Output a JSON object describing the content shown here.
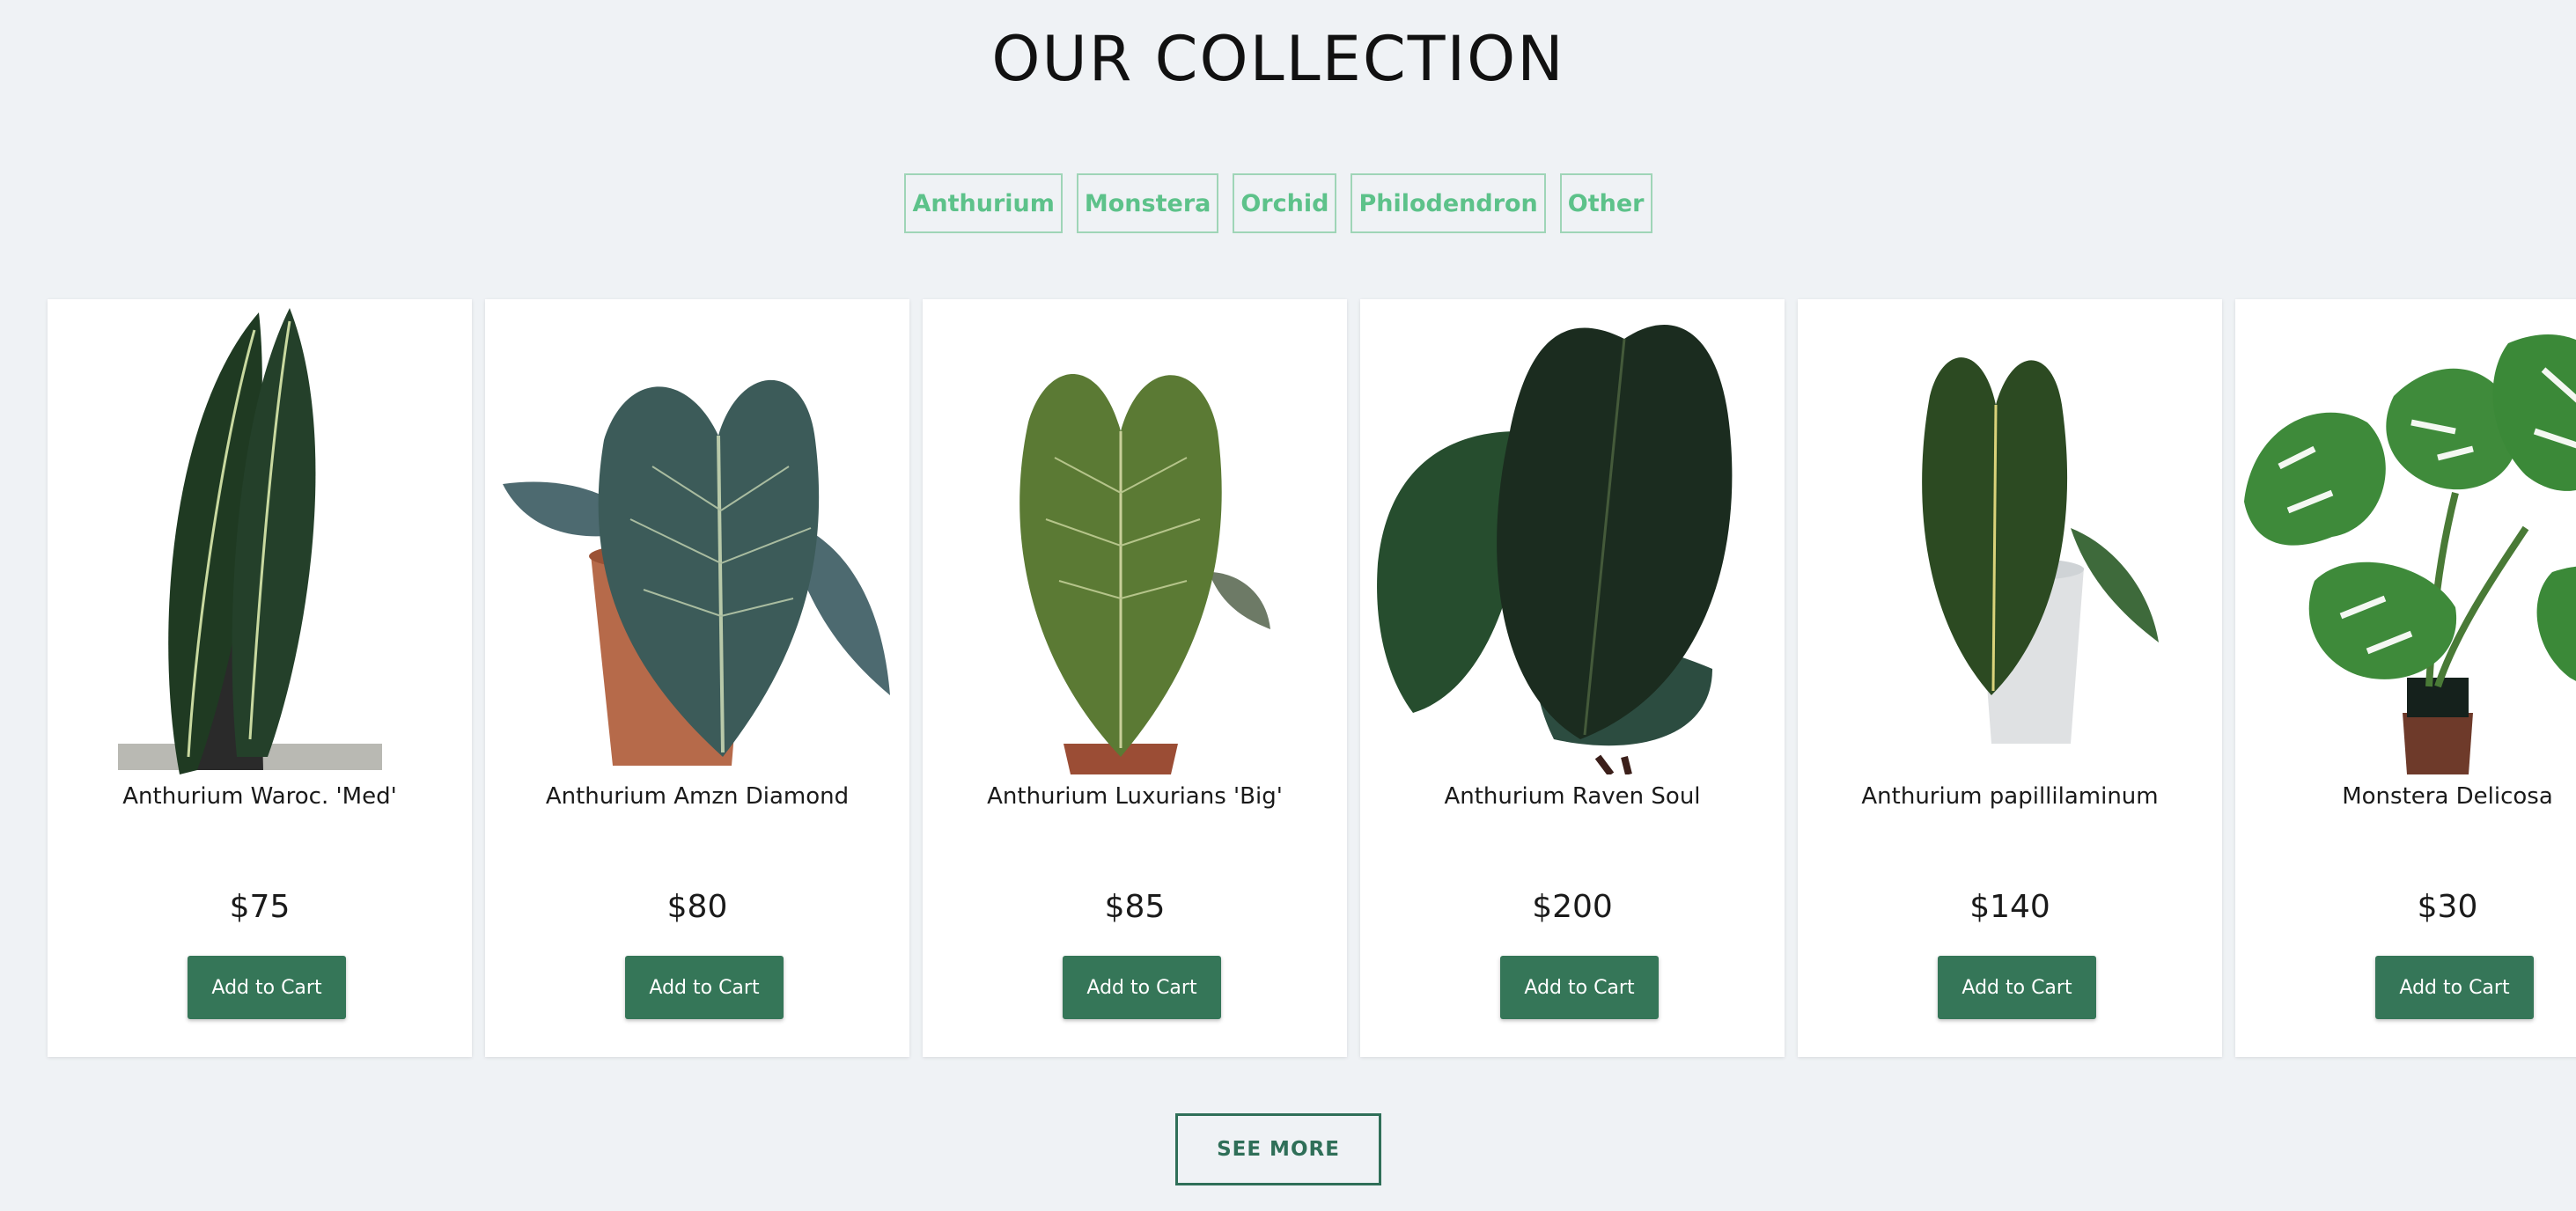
{
  "header": {
    "title": "OUR COLLECTION"
  },
  "filters": [
    {
      "label": "Anthurium"
    },
    {
      "label": "Monstera"
    },
    {
      "label": "Orchid"
    },
    {
      "label": "Philodendron"
    },
    {
      "label": "Other"
    }
  ],
  "products": [
    {
      "name": "Anthurium Waroc. 'Med'",
      "price": "$75",
      "button": "Add to Cart"
    },
    {
      "name": "Anthurium Amzn Diamond",
      "price": "$80",
      "button": "Add to Cart"
    },
    {
      "name": "Anthurium Luxurians 'Big'",
      "price": "$85",
      "button": "Add to Cart"
    },
    {
      "name": "Anthurium Raven Soul",
      "price": "$200",
      "button": "Add to Cart"
    },
    {
      "name": "Anthurium papillilaminum",
      "price": "$140",
      "button": "Add to Cart"
    },
    {
      "name": "Monstera Delicosa",
      "price": "$30",
      "button": "Add to Cart"
    }
  ],
  "footer": {
    "see_more_label": "SEE MORE"
  },
  "colors": {
    "background": "#eff2f5",
    "accent_green": "#357658",
    "filter_green": "#5dc28a",
    "see_more_border": "#2f6f58"
  }
}
